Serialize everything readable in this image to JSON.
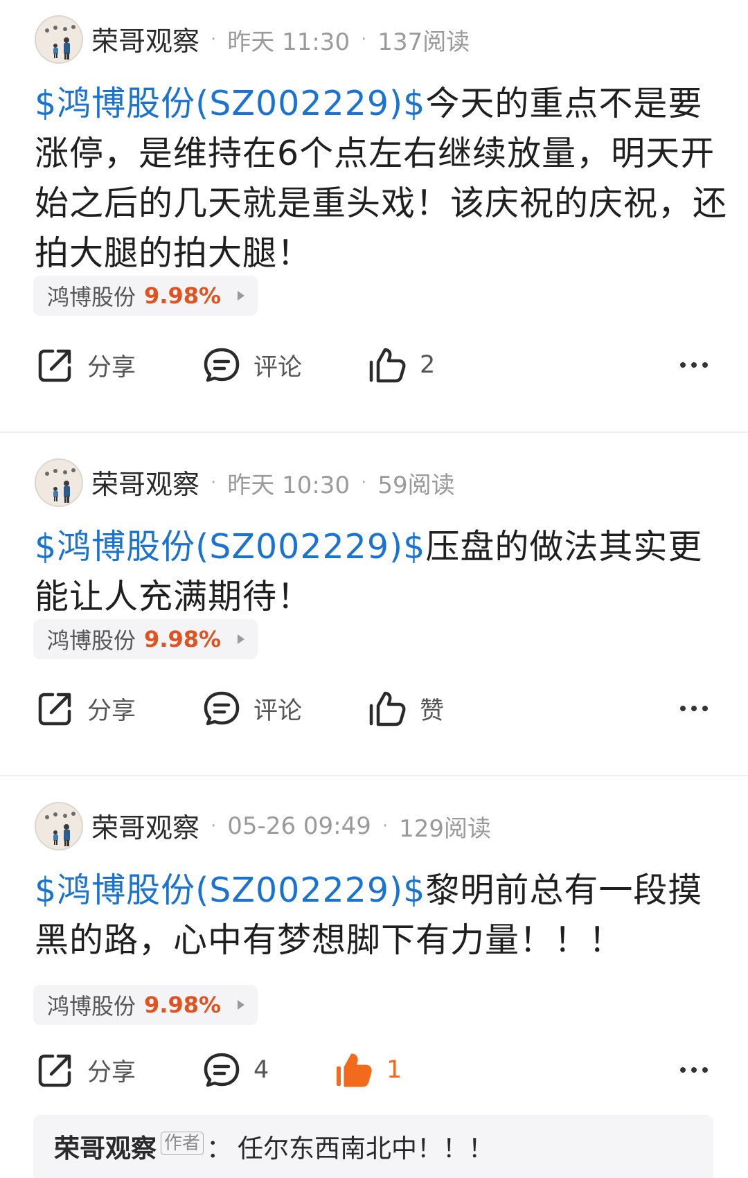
{
  "posts": [
    {
      "author": "荣哥观察",
      "time": "昨天 11:30",
      "reads": "137阅读",
      "stock_link": "$鸿博股份(SZ002229)$",
      "text": "今天的重点不是要涨停，是维持在6个点左右继续放量，明天开始之后的几天就是重头戏！该庆祝的庆祝，还拍大腿的拍大腿！",
      "chip": {
        "name": "鸿博股份",
        "pct": "9.98%"
      },
      "share_label": "分享",
      "comment_label": "评论",
      "like_label": "2",
      "liked": false
    },
    {
      "author": "荣哥观察",
      "time": "昨天 10:30",
      "reads": "59阅读",
      "stock_link": "$鸿博股份(SZ002229)$",
      "text": "压盘的做法其实更能让人充满期待！",
      "chip": {
        "name": "鸿博股份",
        "pct": "9.98%"
      },
      "share_label": "分享",
      "comment_label": "评论",
      "like_label": "赞",
      "liked": false
    },
    {
      "author": "荣哥观察",
      "time": "05-26 09:49",
      "reads": "129阅读",
      "stock_link": "$鸿博股份(SZ002229)$",
      "text": "黎明前总有一段摸黑的路，心中有梦想脚下有力量！！！",
      "chip": {
        "name": "鸿博股份",
        "pct": "9.98%"
      },
      "share_label": "分享",
      "comment_label": "4",
      "like_label": "1",
      "liked": true,
      "reply": {
        "name": "荣哥观察",
        "tag": "作者",
        "colon": "：",
        "text": "任尔东西南北中！！！"
      }
    }
  ],
  "colors": {
    "link": "#1b73cf",
    "gain": "#e0521e",
    "liked": "#f26b1d"
  },
  "icons": [
    "avatar-image",
    "share-icon",
    "comment-icon",
    "like-icon",
    "like-filled-icon",
    "more-icon",
    "chevron-right-icon"
  ]
}
